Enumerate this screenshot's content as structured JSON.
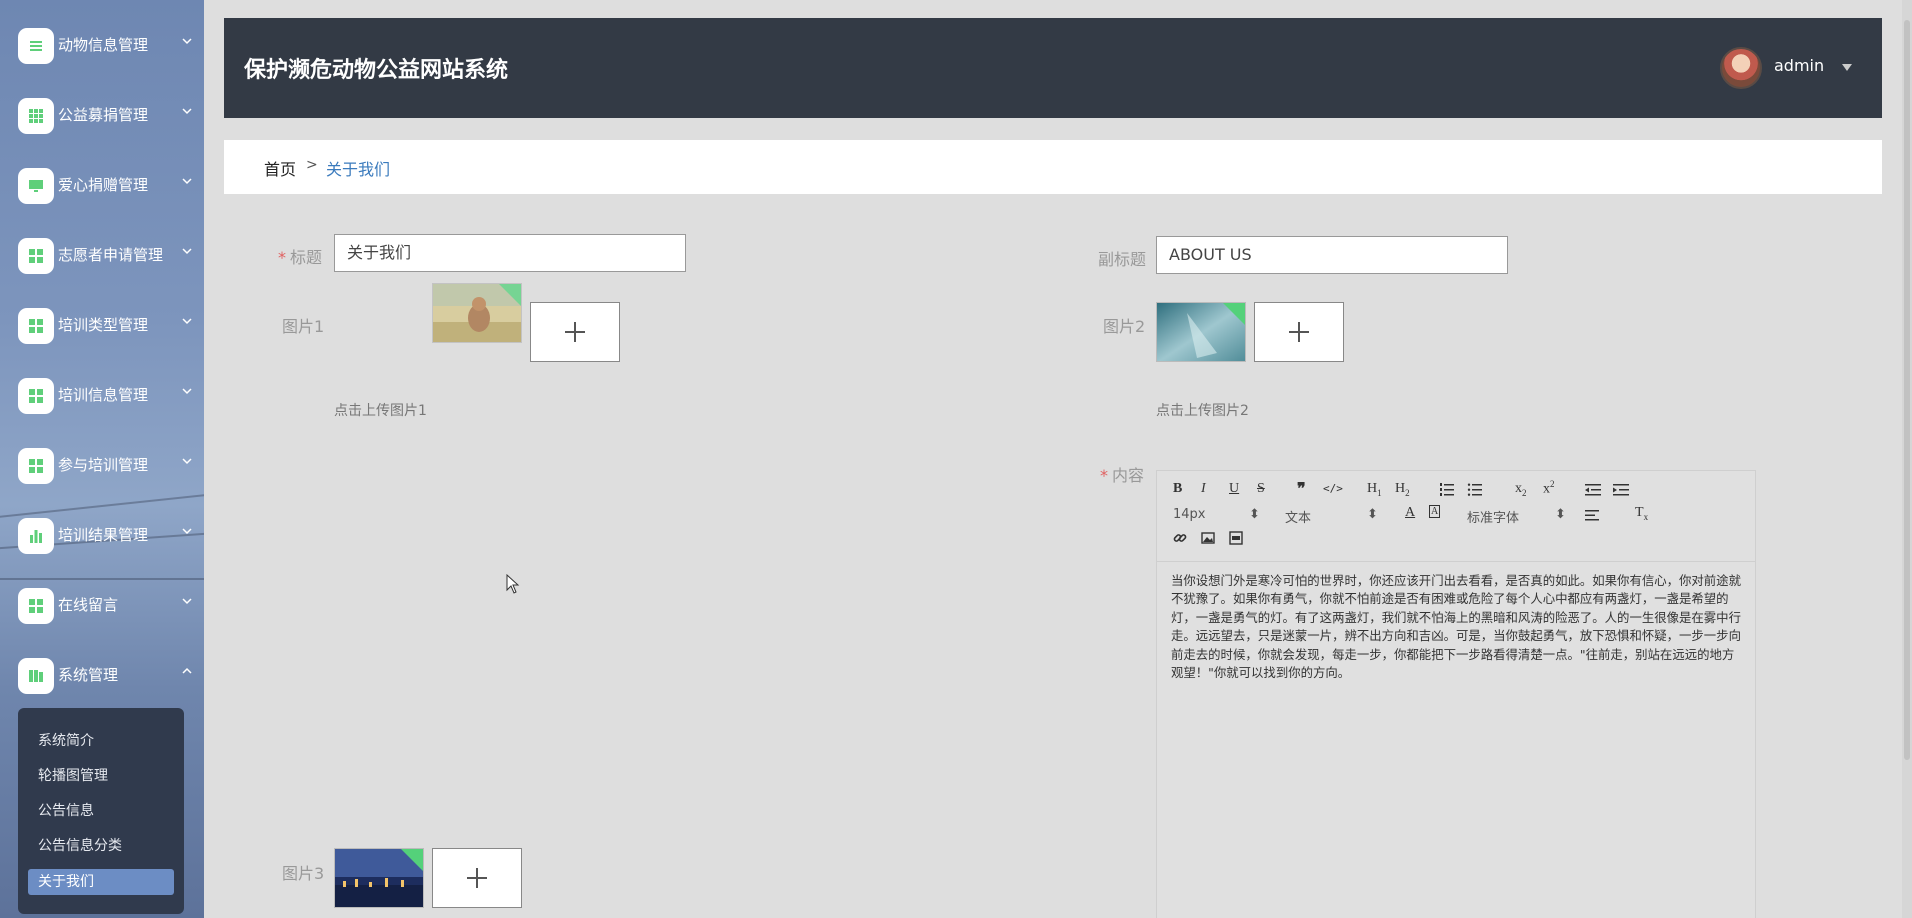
{
  "app": {
    "title": "保护濒危动物公益网站系统",
    "user": "admin"
  },
  "sidebar": {
    "items": [
      {
        "label": "动物信息管理",
        "icon": "list-icon"
      },
      {
        "label": "公益募捐管理",
        "icon": "grid-icon"
      },
      {
        "label": "爱心捐赠管理",
        "icon": "monitor-icon"
      },
      {
        "label": "志愿者申请管理",
        "icon": "apps-icon"
      },
      {
        "label": "培训类型管理",
        "icon": "apps-icon"
      },
      {
        "label": "培训信息管理",
        "icon": "apps-icon"
      },
      {
        "label": "参与培训管理",
        "icon": "apps-icon"
      },
      {
        "label": "培训结果管理",
        "icon": "bar-chart-icon"
      },
      {
        "label": "在线留言",
        "icon": "apps-icon"
      },
      {
        "label": "系统管理",
        "icon": "book-icon"
      }
    ],
    "submenu": [
      "系统简介",
      "轮播图管理",
      "公告信息",
      "公告信息分类",
      "关于我们"
    ],
    "active_submenu": "关于我们"
  },
  "breadcrumb": {
    "home": "首页",
    "separator": ">",
    "current": "关于我们"
  },
  "form": {
    "title_label": "标题",
    "title_value": "关于我们",
    "subtitle_label": "副标题",
    "subtitle_value": "ABOUT US",
    "image1_label": "图片1",
    "image1_hint": "点击上传图片1",
    "image2_label": "图片2",
    "image2_hint": "点击上传图片2",
    "image3_label": "图片3",
    "content_label": "内容"
  },
  "editor": {
    "font_size": "14px",
    "text_type": "文本",
    "font_family": "标准字体",
    "content": "当你设想门外是寒冷可怕的世界时，你还应该开门出去看看，是否真的如此。如果你有信心，你对前途就不犹豫了。如果你有勇气，你就不怕前途是否有困难或危险了每个人心中都应有两盏灯，一盏是希望的灯，一盏是勇气的灯。有了这两盏灯，我们就不怕海上的黑暗和风涛的险恶了。人的一生很像是在雾中行走。远远望去，只是迷蒙一片，辨不出方向和吉凶。可是，当你鼓起勇气，放下恐惧和怀疑，一步一步向前走去的时候，你就会发现，每走一步，你都能把下一步路看得清楚一点。\"往前走，别站在远远的地方观望！\"你就可以找到你的方向。"
  },
  "colors": {
    "header_bg": "#333a45",
    "accent": "#3b7bbd",
    "required": "#e06060",
    "active_submenu": "#6c8dc4"
  }
}
